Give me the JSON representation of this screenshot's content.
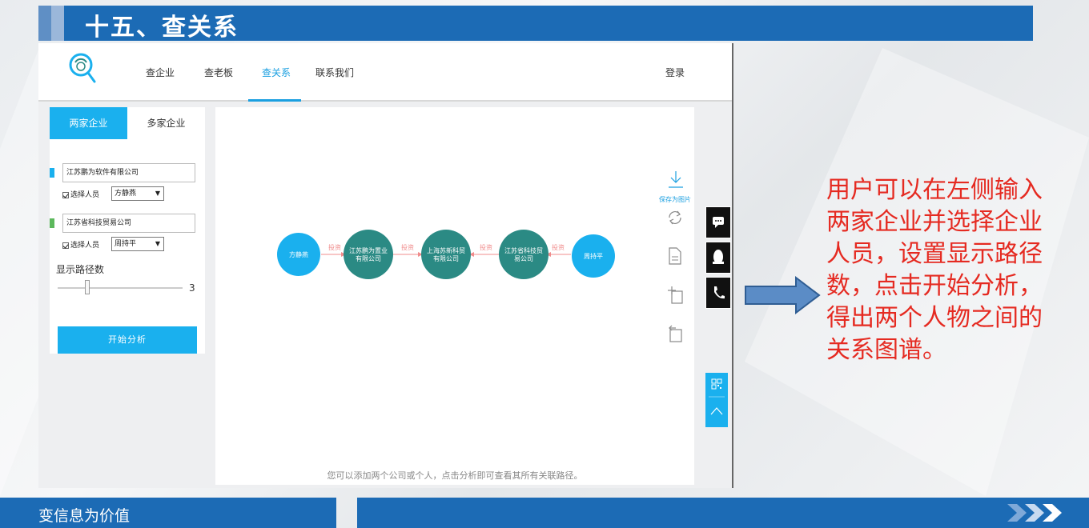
{
  "header": {
    "title": "十五、查关系"
  },
  "nav": {
    "items": [
      {
        "label": "查企业"
      },
      {
        "label": "查老板"
      },
      {
        "label": "查关系"
      },
      {
        "label": "联系我们"
      }
    ],
    "login": "登录"
  },
  "panel": {
    "tabs": [
      {
        "label": "两家企业"
      },
      {
        "label": "多家企业"
      }
    ],
    "company1": {
      "name": "江苏鹏为软件有限公司",
      "check_label": "选择人员",
      "person": "方静燕"
    },
    "company2": {
      "name": "江苏省科技贸易公司",
      "check_label": "选择人员",
      "person": "周持平"
    },
    "path_label": "显示路径数",
    "path_count": "3",
    "start_button": "开始分析"
  },
  "graph": {
    "nodes": [
      {
        "line1": "方静燕",
        "line2": ""
      },
      {
        "line1": "江苏鹏为置业",
        "line2": "有限公司"
      },
      {
        "line1": "上海苏新科贸",
        "line2": "有限公司"
      },
      {
        "line1": "江苏省科技贸",
        "line2": "易公司"
      },
      {
        "line1": "周持平",
        "line2": ""
      }
    ],
    "edges": [
      {
        "label": "投资"
      },
      {
        "label": "投资"
      },
      {
        "label": "投资"
      },
      {
        "label": "投资"
      }
    ],
    "save_label": "保存为图片",
    "hint": "您可以添加两个公司或个人，点击分析即可查看其所有关联路径。"
  },
  "description": "用户可以在左侧输入两家企业并选择企业人员，设置显示路径数，点击开始分析，得出两个人物之间的关系图谱。",
  "footer": {
    "slogan": "变信息为价值"
  },
  "colors": {
    "brand_blue": "#1c6bb5",
    "accent": "#1ab0ee",
    "person_node": "#1ab0ee",
    "company_node": "#2b8a84",
    "edge": "#f08c8c",
    "description_text": "#e52a21"
  }
}
